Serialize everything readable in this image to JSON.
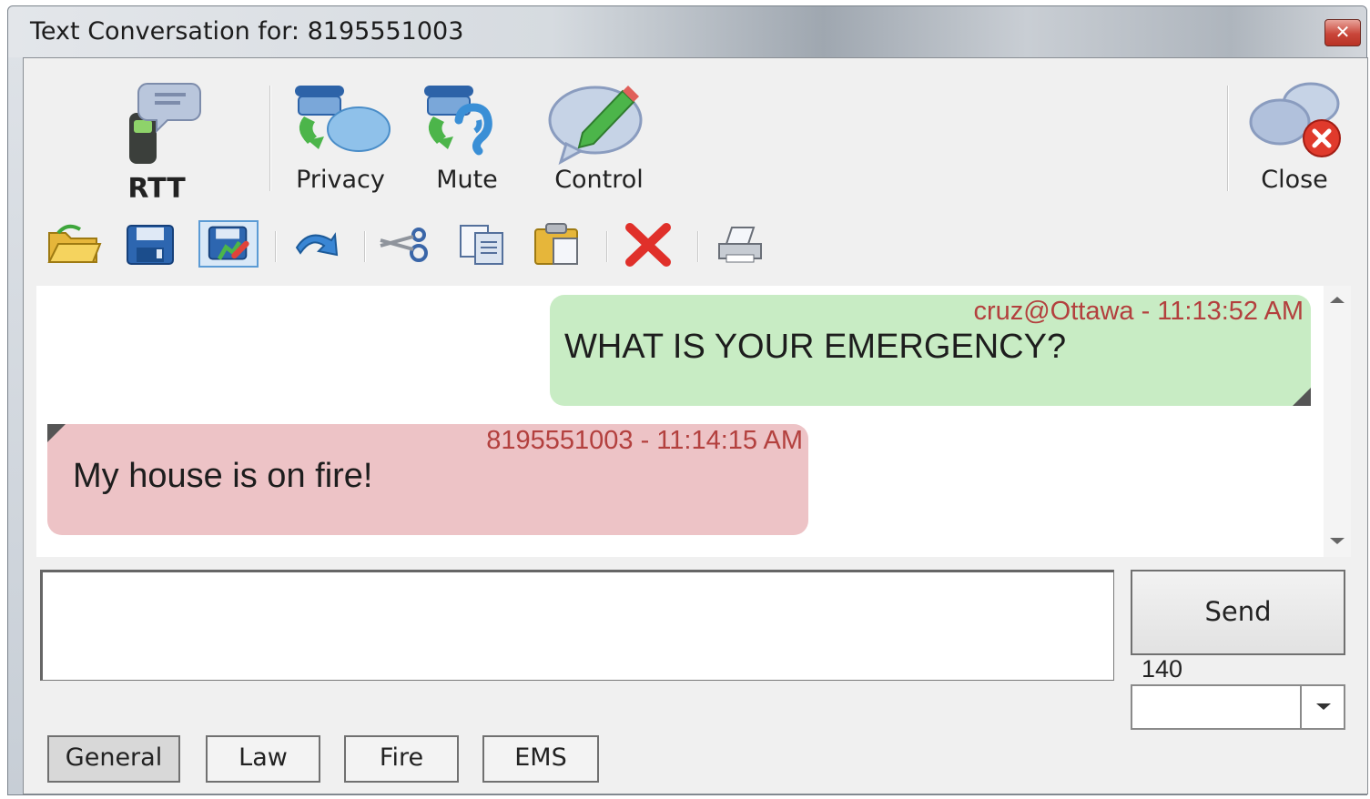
{
  "window": {
    "title": "Text Conversation for: 8195551003",
    "close_glyph": "✕"
  },
  "main_toolbar": {
    "rtt": {
      "label": "RTT",
      "icon": "rtt-phone-icon"
    },
    "privacy": {
      "label": "Privacy",
      "icon": "privacy-phone-icon"
    },
    "mute": {
      "label": "Mute",
      "icon": "mute-phone-icon"
    },
    "control": {
      "label": "Control",
      "icon": "control-pencil-icon"
    },
    "close": {
      "label": "Close",
      "icon": "close-chat-icon"
    }
  },
  "edit_toolbar": {
    "icons": [
      "open-folder-icon",
      "save-icon",
      "save-as-icon",
      "undo-icon",
      "cut-icon",
      "copy-icon",
      "paste-icon",
      "delete-icon",
      "print-icon"
    ],
    "pressed": "save-as-icon"
  },
  "conversation": {
    "messages": [
      {
        "sender": "cruz@Ottawa",
        "time": "11:13:52 AM",
        "meta": "cruz@Ottawa - 11:13:52 AM",
        "text": "WHAT IS YOUR EMERGENCY?",
        "direction": "outgoing",
        "color": "#c8ecc4"
      },
      {
        "sender": "8195551003",
        "time": "11:14:15 AM",
        "meta": "8195551003 - 11:14:15 AM",
        "text": "My house is on fire!",
        "direction": "incoming",
        "color": "#edc3c6"
      }
    ]
  },
  "composer": {
    "value": "",
    "send_label": "Send",
    "char_count": "140",
    "combo_value": ""
  },
  "tabs": [
    {
      "label": "General",
      "active": true
    },
    {
      "label": "Law",
      "active": false
    },
    {
      "label": "Fire",
      "active": false
    },
    {
      "label": "EMS",
      "active": false
    }
  ]
}
